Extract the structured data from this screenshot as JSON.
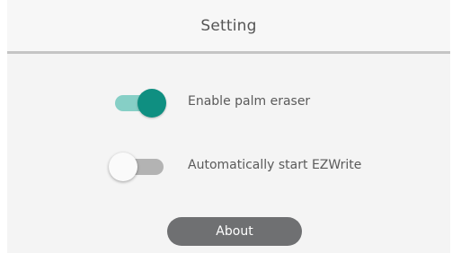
{
  "header": {
    "title": "Setting"
  },
  "settings": [
    {
      "label": "Enable palm eraser",
      "enabled": true
    },
    {
      "label": "Automatically start EZWrite",
      "enabled": false
    }
  ],
  "about_button": {
    "label": "About"
  },
  "colors": {
    "toggle_on_thumb": "#0f8f81",
    "toggle_on_track": "#86cfc6",
    "toggle_off_track": "#b3b3b3",
    "button_bg": "#6f7072"
  }
}
